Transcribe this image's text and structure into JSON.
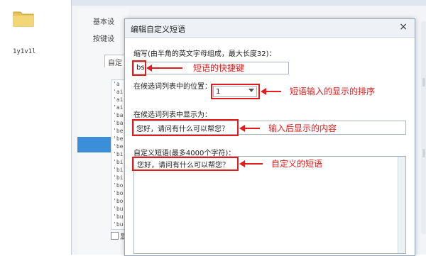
{
  "desktop": {
    "label": "1y1v1l"
  },
  "background_window": {
    "nav": [
      "基本设",
      "按键设"
    ],
    "tab_label": "自定",
    "list_items": [
      "'a",
      "'ai",
      "'ai",
      "'ai",
      "'ba",
      "'ba",
      "'be",
      "'be",
      "'be",
      "'bi",
      "'bi",
      "'bi",
      "'bi",
      "'bo",
      "'bo",
      "'bo",
      "'bu",
      "'bu",
      "'bu"
    ],
    "checkbox_label": "显",
    "selected_color": "#3a8fd8"
  },
  "dialog": {
    "title": "编辑自定义短语",
    "close_icon": "×",
    "abbr_label": "缩写(由半角的英文字母组成，最大长度32)：",
    "abbr_value": "bs",
    "position_label": "在候选词列表中的位置：",
    "position_value": "1",
    "display_label": "在候选词列表中显示为：",
    "display_value": "您好，请问有什么可以帮您？",
    "phrase_label": "自定义短语(最多4000个字符)：",
    "phrase_value": "您好，请问有什么可以帮您？"
  },
  "annotations": {
    "abbr": "短语的快捷键",
    "position": "短语输入的显示的排序",
    "display": "输入后显示的内容",
    "phrase": "自定义的短语",
    "color": "#e21b1b"
  }
}
